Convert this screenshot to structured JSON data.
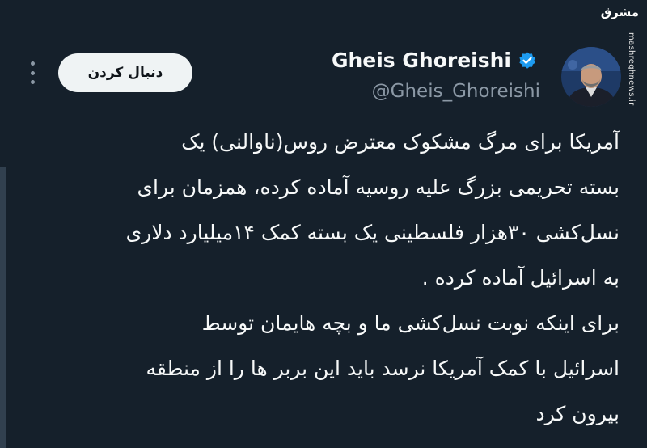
{
  "watermark": {
    "logo": "مشرق",
    "url": "mashreghnews.ir"
  },
  "author": {
    "display_name": "Gheis Ghoreishi",
    "handle": "@Gheis_Ghoreishi",
    "verified_icon": "verified-badge-icon",
    "avatar_icon": "avatar-photo"
  },
  "actions": {
    "follow_label": "دنبال کردن",
    "more_icon": "more-options-icon"
  },
  "tweet": {
    "lines": [
      "آمریکا برای مرگ مشکوک معترض روس(ناوالنی) یک",
      "بسته تحریمی بزرگ علیه روسیه آماده کرده، همزمان برای",
      "نسل‌کشی ۳۰هزار فلسطینی یک بسته کمک ۱۴میلیارد دلاری",
      "به اسرائیل آماده کرده .",
      "برای اینکه نوبت نسل‌کشی ما و بچه هایمان توسط",
      "اسرائیل با کمک آمریکا نرسد باید این بربر ها را از منطقه",
      "بیرون کرد"
    ]
  },
  "colors": {
    "background": "#15202b",
    "verified": "#1d9bf0",
    "secondary_text": "#8b98a5",
    "button_bg": "#eff3f4"
  }
}
